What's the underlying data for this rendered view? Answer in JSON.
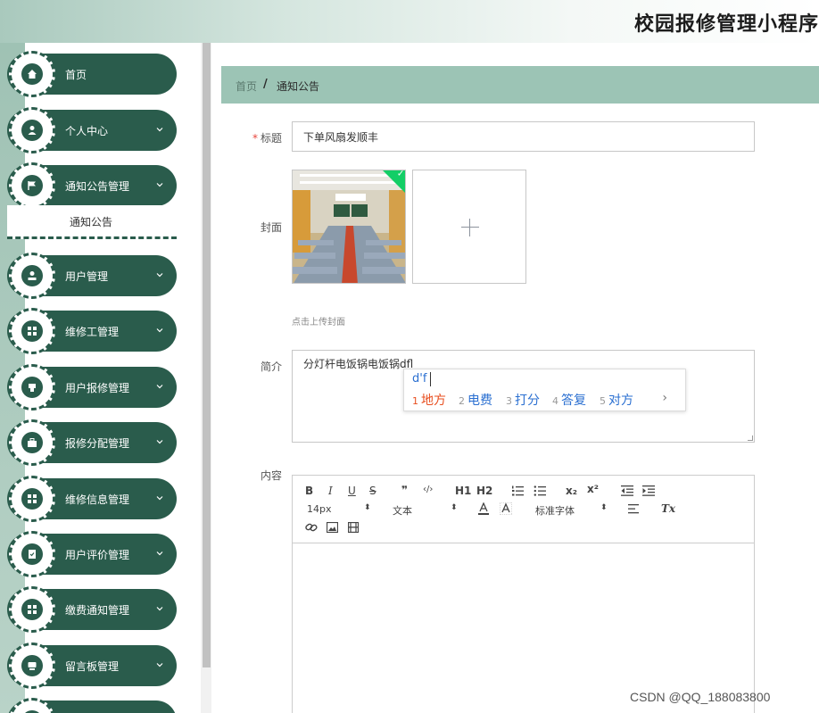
{
  "header": {
    "app_title": "校园报修管理小程序"
  },
  "sidebar": {
    "items": [
      {
        "label": "首页",
        "icon": "home-icon"
      },
      {
        "label": "个人中心",
        "icon": "user-icon"
      },
      {
        "label": "通知公告管理",
        "icon": "flag-icon"
      },
      {
        "label": "用户管理",
        "icon": "person-icon"
      },
      {
        "label": "维修工管理",
        "icon": "grid-icon"
      },
      {
        "label": "用户报修管理",
        "icon": "clipboard-icon"
      },
      {
        "label": "报修分配管理",
        "icon": "briefcase-icon"
      },
      {
        "label": "维修信息管理",
        "icon": "grid-icon"
      },
      {
        "label": "用户评价管理",
        "icon": "checklist-icon"
      },
      {
        "label": "缴费通知管理",
        "icon": "grid-icon"
      },
      {
        "label": "留言板管理",
        "icon": "message-icon"
      }
    ],
    "submenu": {
      "label": "通知公告"
    }
  },
  "breadcrumb": {
    "home": "首页",
    "separator": "/",
    "current": "通知公告"
  },
  "form": {
    "title_label": "标题",
    "required_mark": "*",
    "title_value": "下单风扇发顺丰",
    "cover_label": "封面",
    "cover_check": "✓",
    "cover_hint": "点击上传封面",
    "intro_label": "简介",
    "intro_value": "分灯杆电饭锅电饭锅dfl",
    "content_label": "内容"
  },
  "ime": {
    "input": "d'f",
    "candidates": [
      {
        "num": "1",
        "text": "地方"
      },
      {
        "num": "2",
        "text": "电费"
      },
      {
        "num": "3",
        "text": "打分"
      },
      {
        "num": "4",
        "text": "答复"
      },
      {
        "num": "5",
        "text": "对方"
      }
    ],
    "more": "›"
  },
  "editor": {
    "font_size": "14px",
    "text_style": "文本",
    "font_family": "标准字体",
    "bold": "B",
    "italic": "I",
    "underline": "U",
    "strike": "S",
    "quote": "❞",
    "code": "‹/›",
    "h1": "H1",
    "h2": "H2",
    "sub": "x₂",
    "sup": "x²",
    "clear": "Tx"
  },
  "watermark": "CSDN @QQ_188083800",
  "colors": {
    "primary": "#2a5c4c",
    "breadcrumb_bg": "#9cc4b5",
    "required": "#e8453c",
    "ime_highlight": "#e84e1f",
    "ime_text": "#2a6fd1"
  }
}
